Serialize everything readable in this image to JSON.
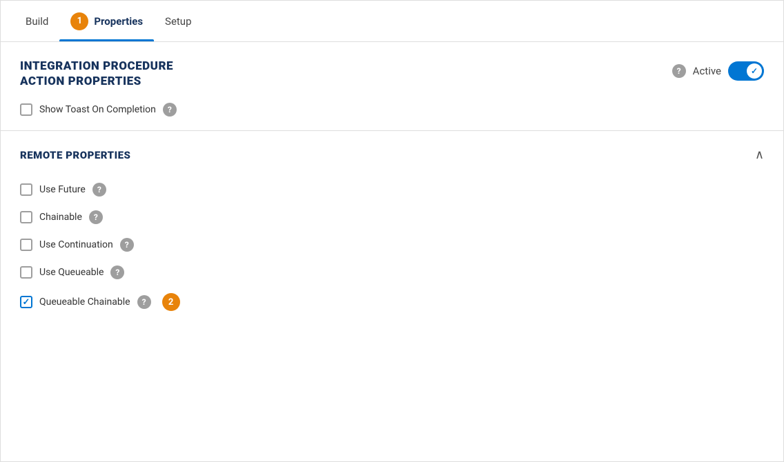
{
  "tabs": [
    {
      "id": "build",
      "label": "Build",
      "active": false,
      "badge": null
    },
    {
      "id": "properties",
      "label": "Properties",
      "active": true,
      "badge": "1"
    },
    {
      "id": "setup",
      "label": "Setup",
      "active": false,
      "badge": null
    }
  ],
  "ipa_section": {
    "title_line1": "INTEGRATION PROCEDURE",
    "title_line2": "ACTION PROPERTIES",
    "active_label": "Active",
    "toggle_on": true,
    "show_toast_label": "Show Toast On Completion",
    "show_toast_checked": false
  },
  "remote_section": {
    "title": "REMOTE PROPERTIES",
    "options": [
      {
        "id": "use_future",
        "label": "Use Future",
        "checked": false,
        "badge": null
      },
      {
        "id": "chainable",
        "label": "Chainable",
        "checked": false,
        "badge": null
      },
      {
        "id": "use_continuation",
        "label": "Use Continuation",
        "checked": false,
        "badge": null
      },
      {
        "id": "use_queueable",
        "label": "Use Queueable",
        "checked": false,
        "badge": null
      },
      {
        "id": "queueable_chainable",
        "label": "Queueable Chainable",
        "checked": true,
        "badge": "2"
      }
    ]
  },
  "icons": {
    "help": "?",
    "check": "✓",
    "collapse": "∧"
  }
}
